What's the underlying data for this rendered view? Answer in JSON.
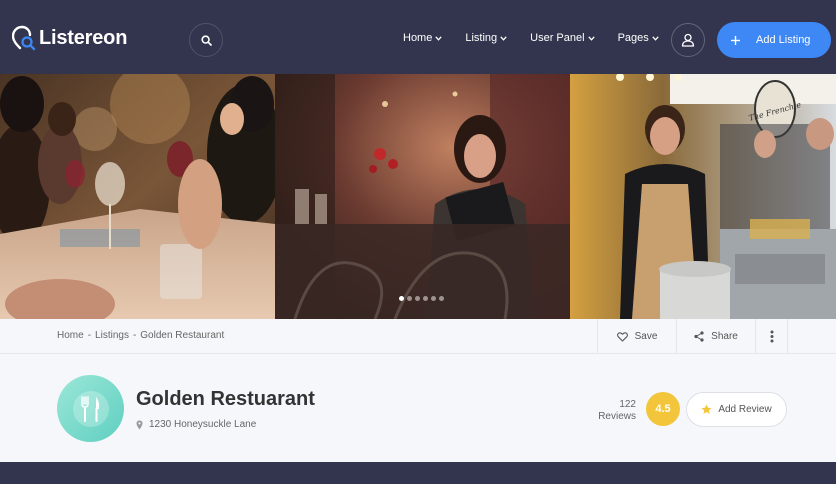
{
  "brand": {
    "name": "Listereon"
  },
  "nav": {
    "items": [
      {
        "label": "Home"
      },
      {
        "label": "Listing"
      },
      {
        "label": "User Panel"
      },
      {
        "label": "Pages"
      }
    ],
    "add_listing_label": "Add Listing"
  },
  "gallery": {
    "slide_count": 6,
    "active_slide": 1,
    "sign_text": "The Frenchie"
  },
  "breadcrumb": {
    "items": [
      "Home",
      "Listings",
      "Golden Restaurant"
    ],
    "separator": "-"
  },
  "actions": {
    "save_label": "Save",
    "share_label": "Share"
  },
  "listing": {
    "title": "Golden Restuarant",
    "address": "1230 Honeysuckle Lane",
    "reviews_count": "122",
    "reviews_label": "Reviews",
    "rating": "4.5",
    "add_review_label": "Add Review"
  },
  "colors": {
    "header_bg": "#33354f",
    "accent_blue": "#3d88f5",
    "rating_yellow": "#f3c53a",
    "avatar_teal": "#5fcfc0"
  },
  "icons": {
    "logo": "magnifier-pin-icon",
    "search": "search-icon",
    "user": "user-icon",
    "add": "plus-icon",
    "save": "heart-icon",
    "share": "share-icon",
    "more": "vertical-dots-icon",
    "location": "map-pin-icon",
    "star": "star-icon",
    "category": "fork-knife-icon"
  }
}
